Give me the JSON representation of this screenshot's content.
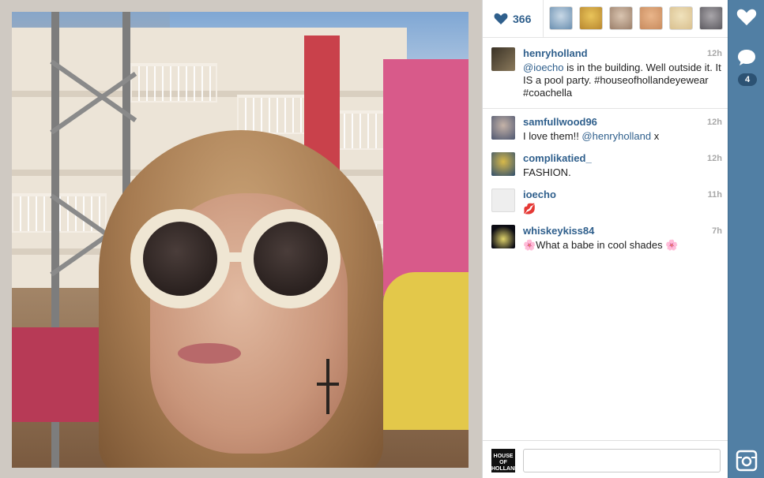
{
  "likes": {
    "count": "366",
    "likers": [
      {
        "name": "liker-1",
        "color": "#6a8fb0"
      },
      {
        "name": "liker-2",
        "color": "#b8872f"
      },
      {
        "name": "liker-3",
        "color": "#9b7f6a"
      },
      {
        "name": "liker-4",
        "color": "#c88b5e"
      },
      {
        "name": "liker-5",
        "color": "#d9c08f"
      },
      {
        "name": "liker-6",
        "color": "#5c5a60"
      }
    ]
  },
  "caption": {
    "username": "henryholland",
    "time": "12h",
    "mention": "@ioecho",
    "text_after_mention": " is in the building. Well outside it. It IS a pool party. #houseofhollandeyewear #coachella"
  },
  "comments": [
    {
      "username": "samfullwood96",
      "time": "12h",
      "text_before": "I love them!! ",
      "mention": "@henryholland",
      "text_after": " x"
    },
    {
      "username": "complikatied_",
      "time": "12h",
      "text_before": "FASHION.",
      "mention": "",
      "text_after": ""
    },
    {
      "username": "ioecho",
      "time": "11h",
      "text_before": "💋",
      "mention": "",
      "text_after": ""
    },
    {
      "username": "whiskeykiss84",
      "time": "7h",
      "text_before": "🌸What a babe in cool shades 🌸",
      "mention": "",
      "text_after": ""
    }
  ],
  "compose": {
    "avatar_text": "HOUSE OF HOLLAND",
    "placeholder": ""
  },
  "rail": {
    "comment_count": "4"
  },
  "colors": {
    "link": "#2f5f8c",
    "rail": "#517fa4",
    "time": "#a8a8a8"
  }
}
